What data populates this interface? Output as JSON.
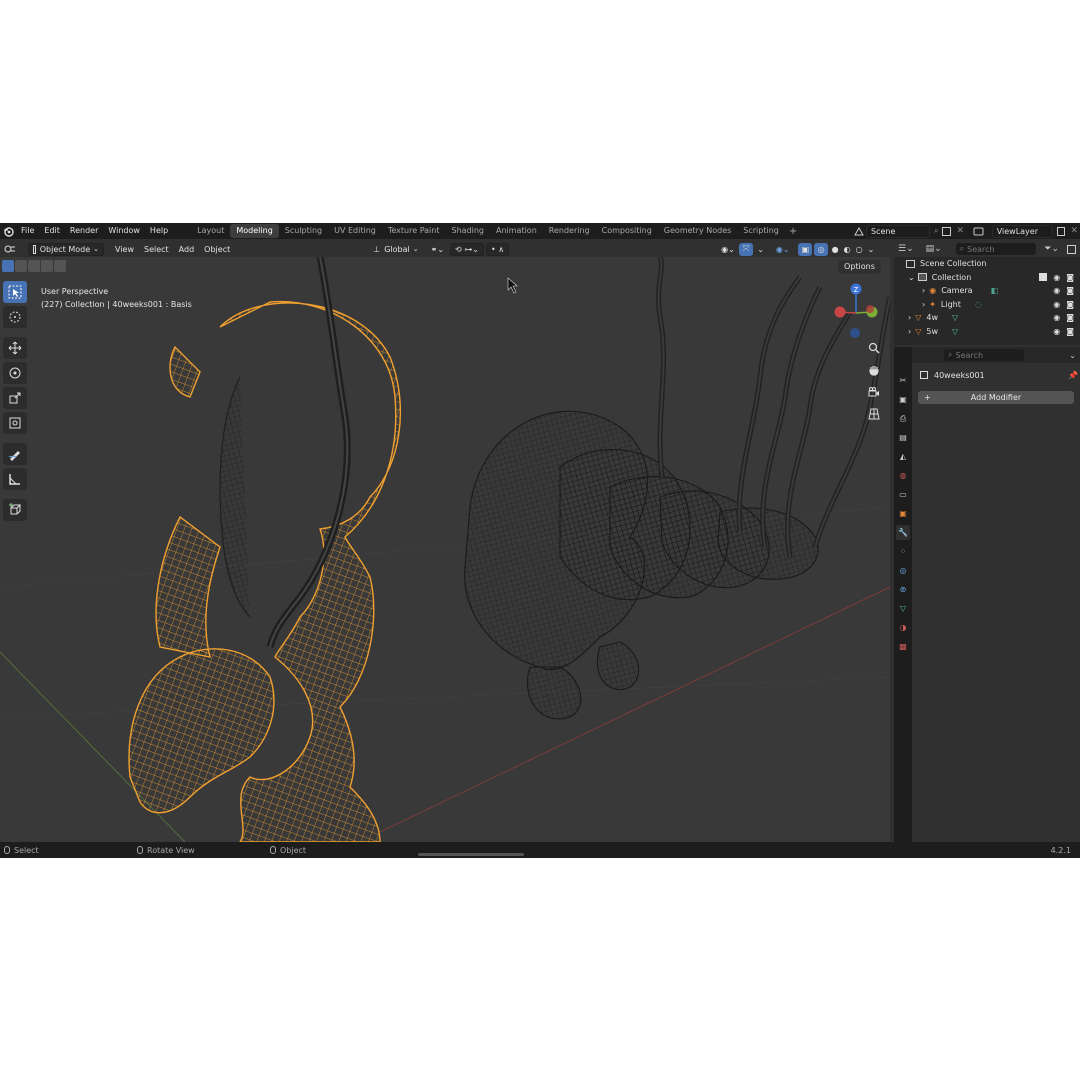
{
  "menubar": {
    "items": [
      "File",
      "Edit",
      "Render",
      "Window",
      "Help"
    ],
    "workspace_tabs": [
      "Layout",
      "Modeling",
      "Sculpting",
      "UV Editing",
      "Texture Paint",
      "Shading",
      "Animation",
      "Rendering",
      "Compositing",
      "Geometry Nodes",
      "Scripting"
    ],
    "active_tab": "Modeling",
    "add_tab": "+",
    "scene": "Scene",
    "view_layer": "ViewLayer"
  },
  "viewport_header": {
    "mode": "Object Mode",
    "menus": [
      "View",
      "Select",
      "Add",
      "Object"
    ],
    "transform_orientation": "Global",
    "options": "Options"
  },
  "viewport": {
    "perspective": "User Perspective",
    "collection_info": "(227) Collection | 40weeks001 : Basis",
    "gizmo_axis_label": "Z"
  },
  "outliner": {
    "search_placeholder": "Search",
    "rows": [
      {
        "label": "Scene Collection"
      },
      {
        "label": "Collection"
      },
      {
        "label": "Camera"
      },
      {
        "label": "Light"
      },
      {
        "label": "4w"
      },
      {
        "label": "5w"
      }
    ]
  },
  "properties": {
    "search_placeholder": "Search",
    "object_name": "40weeks001",
    "add_modifier": "Add Modifier",
    "add_modifier_icon": "+"
  },
  "statusbar": {
    "select": "Select",
    "rotate_view": "Rotate View",
    "object": "Object",
    "version": "4.2.1"
  },
  "colors": {
    "accent": "#4772b3",
    "selected_wire": "#f0a030",
    "unselected_wire": "#1a1a1a",
    "background": "#393939"
  }
}
